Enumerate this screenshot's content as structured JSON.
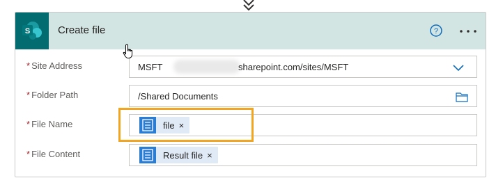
{
  "action": {
    "title": "Create file",
    "icons": {
      "app": "sharepoint-logo",
      "help": "help-icon",
      "more": "more-options-icon",
      "connector": "down-arrow-icon"
    }
  },
  "fields": {
    "site_address": {
      "required_mark": "*",
      "label": "Site Address",
      "value_prefix": "MSFT",
      "value_suffix": "sharepoint.com/sites/MSFT",
      "icon": "chevron-down-icon"
    },
    "folder_path": {
      "required_mark": "*",
      "label": "Folder Path",
      "value": "/Shared Documents",
      "icon": "folder-icon"
    },
    "file_name": {
      "required_mark": "*",
      "label": "File Name",
      "token": {
        "label": "file",
        "remove": "×"
      }
    },
    "file_content": {
      "required_mark": "*",
      "label": "File Content",
      "token": {
        "label": "Result file",
        "remove": "×"
      }
    }
  },
  "colors": {
    "header_bg": "#d3e5e2",
    "sharepoint": "#036c70",
    "token_bg": "#dfeaf6",
    "token_icon": "#2b7cd3",
    "highlight": "#f0a623",
    "required": "#a4262c"
  }
}
